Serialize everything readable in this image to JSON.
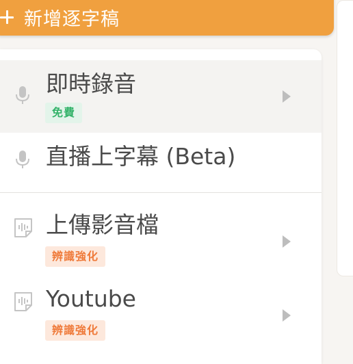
{
  "new_button": {
    "label": "新增逐字稿"
  },
  "menu": {
    "items": [
      {
        "title": "即時錄音",
        "badge": "免費",
        "badge_color": "#34b36a",
        "icon": "microphone-icon",
        "has_chevron": true
      },
      {
        "title": "直播上字幕 (Beta)",
        "badge": "",
        "icon": "microphone-icon",
        "has_chevron": false
      },
      {
        "title": "上傳影音檔",
        "badge": "辨識強化",
        "badge_color": "#ef7a3a",
        "icon": "audio-file-icon",
        "has_chevron": true
      },
      {
        "title": "Youtube",
        "badge": "辨識強化",
        "badge_color": "#ef7a3a",
        "icon": "audio-file-icon",
        "has_chevron": true
      }
    ]
  },
  "colors": {
    "accent": "#f0a03f",
    "badge_free_bg": "#e3f4ea",
    "badge_enhanced_bg": "#fde8dc"
  }
}
